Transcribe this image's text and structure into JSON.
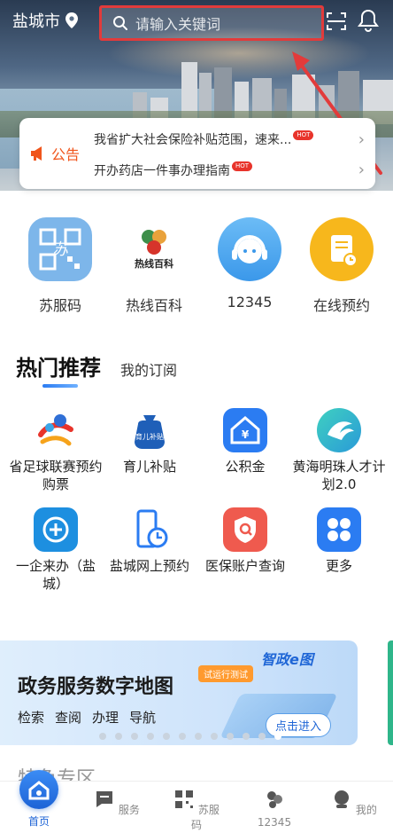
{
  "header": {
    "city": "盐城市",
    "search_placeholder": "请输入关键词"
  },
  "notice": {
    "label": "公告",
    "items": [
      {
        "text": "我省扩大社会保险补贴范围，速来...",
        "badge": "HOT"
      },
      {
        "text": "开办药店一件事办理指南",
        "badge": "HOT"
      }
    ]
  },
  "quick_apps": [
    {
      "label": "苏服码",
      "icon": "qr-code-icon",
      "color": "#7db6ea"
    },
    {
      "label": "热线百科",
      "icon": "hotline-encyclopedia-logo-icon",
      "color": "#ffffff",
      "logo_text": "热线百科"
    },
    {
      "label": "12345",
      "icon": "headset-icon",
      "color": "#4aa6ef"
    },
    {
      "label": "在线预约",
      "icon": "calendar-document-icon",
      "color": "#f7b71c"
    }
  ],
  "tabs": {
    "active": "热门推荐",
    "other": "我的订阅"
  },
  "services": [
    {
      "label": "省足球联赛预约购票",
      "icon": "football-league-icon"
    },
    {
      "label": "育儿补贴",
      "icon": "childcare-subsidy-bag-icon",
      "icon_text": "育儿补贴"
    },
    {
      "label": "公积金",
      "icon": "housing-fund-icon"
    },
    {
      "label": "黄海明珠人才计划2.0",
      "icon": "talent-plan-bird-icon"
    },
    {
      "label": "一企来办（盐城）",
      "icon": "enterprise-service-icon"
    },
    {
      "label": "盐城网上预约",
      "icon": "phone-clock-icon"
    },
    {
      "label": "医保账户查询",
      "icon": "medical-insurance-icon"
    },
    {
      "label": "更多",
      "icon": "more-grid-icon"
    }
  ],
  "banner": {
    "title": "政务服务数字地图",
    "tag": "试运行测试",
    "brand": "智政e图",
    "links": [
      "检索",
      "查阅",
      "办理",
      "导航"
    ],
    "button": "点击进入",
    "page_count": 12,
    "active_page": 11
  },
  "partial_section_title": "特色专区",
  "bottom_nav": [
    {
      "label": "首页",
      "icon": "home-icon"
    },
    {
      "label": "服务",
      "icon": "service-icon"
    },
    {
      "label": "苏服码",
      "icon": "qr-code-icon"
    },
    {
      "label": "12345",
      "icon": "hotline-icon"
    },
    {
      "label": "我的",
      "icon": "profile-icon"
    }
  ],
  "colors": {
    "accent": "#1d63d6",
    "notice": "#f0551c",
    "highlight_box": "#e23b3b"
  }
}
